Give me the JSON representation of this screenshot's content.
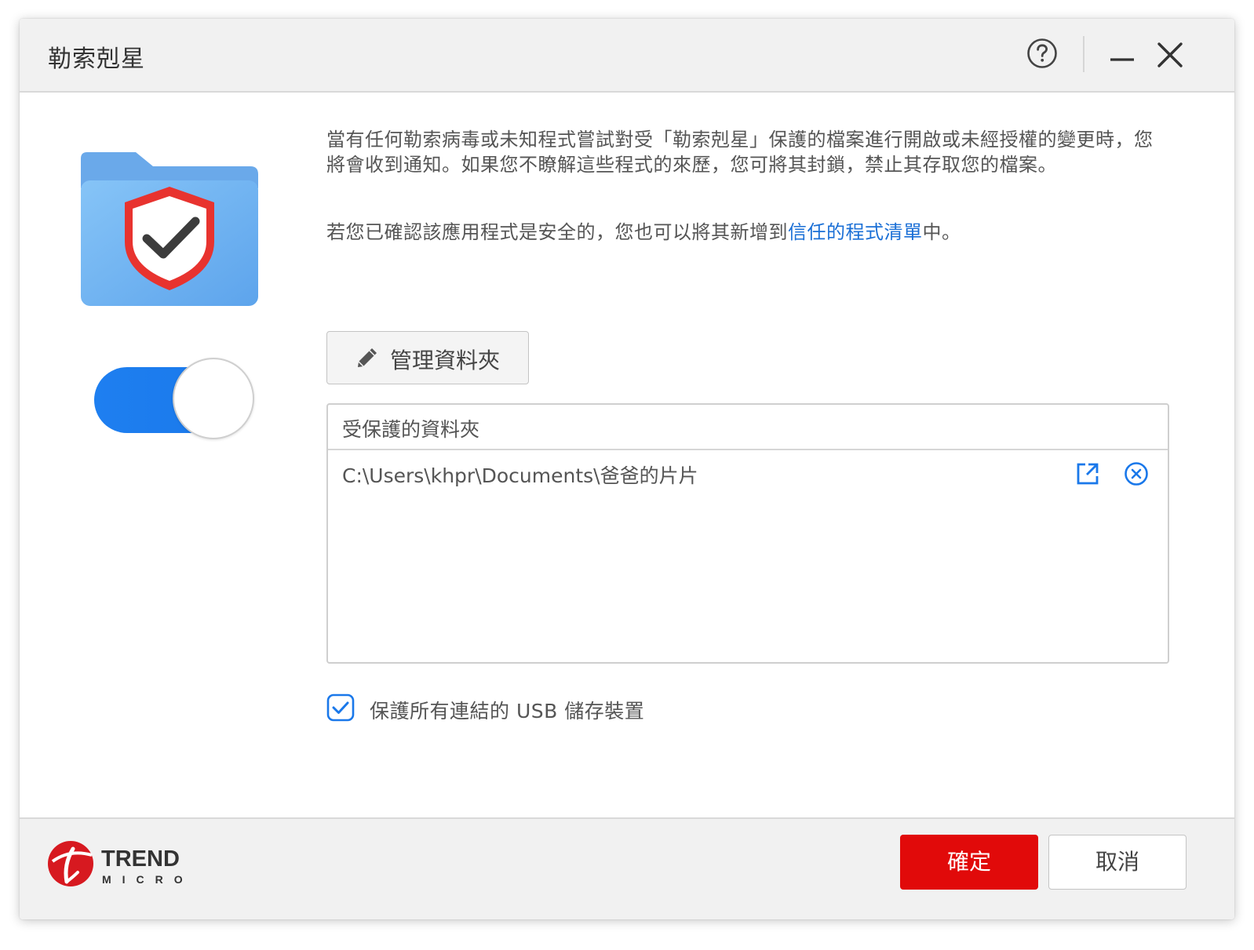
{
  "window": {
    "title": "勒索剋星"
  },
  "titlebar": {
    "help_icon": "help-circle-icon",
    "minimize_icon": "minimize-icon",
    "close_icon": "close-icon"
  },
  "feature": {
    "toggle_on": true,
    "accent_color": "#1e7ff0"
  },
  "description": {
    "paragraph1": "當有任何勒索病毒或未知程式嘗試對受「勒索剋星」保護的檔案進行開啟或未經授權的變更時，您將會收到通知。如果您不瞭解這些程式的來歷，您可將其封鎖，禁止其存取您的檔案。",
    "paragraph2_before": "若您已確認該應用程式是安全的，您也可以將其新增到",
    "paragraph2_link": "信任的程式清單",
    "paragraph2_after": "中。",
    "link_color": "#1a6fd6"
  },
  "manage_button": {
    "label": "管理資料夾",
    "icon": "pencil-icon"
  },
  "folder_list": {
    "header": "受保護的資料夾",
    "rows": [
      {
        "path": "C:\\Users\\khpr\\Documents\\爸爸的片片"
      }
    ]
  },
  "usb": {
    "checked": true,
    "label": "保護所有連結的 USB 儲存裝置"
  },
  "footer": {
    "logo_text_top": "TREND",
    "logo_text_bottom": "MICRO",
    "ok_label": "確定",
    "cancel_label": "取消",
    "ok_color": "#e10a0a"
  }
}
